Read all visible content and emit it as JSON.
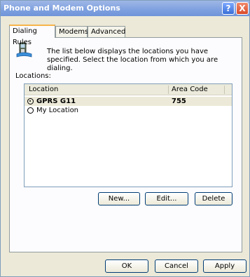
{
  "window": {
    "title": "Phone and Modem Options",
    "help_label": "?",
    "close_label": "X"
  },
  "tabs": [
    {
      "label": "Dialing Rules",
      "active": true
    },
    {
      "label": "Modems",
      "active": false
    },
    {
      "label": "Advanced",
      "active": false
    }
  ],
  "dialing_rules": {
    "description": "The list below displays the locations you have specified. Select the location from which you are dialing.",
    "locations_label": "Locations:",
    "columns": [
      "Location",
      "Area Code"
    ],
    "rows": [
      {
        "location": "GPRS G11",
        "area_code": "755",
        "selected": true
      },
      {
        "location": "My Location",
        "area_code": "",
        "selected": false
      }
    ],
    "buttons": {
      "new": "New...",
      "edit": "Edit...",
      "delete": "Delete"
    }
  },
  "footer": {
    "ok": "OK",
    "cancel": "Cancel",
    "apply": "Apply"
  },
  "icons": {
    "phone": "phone-icon",
    "help": "help-icon",
    "close": "close-icon"
  }
}
